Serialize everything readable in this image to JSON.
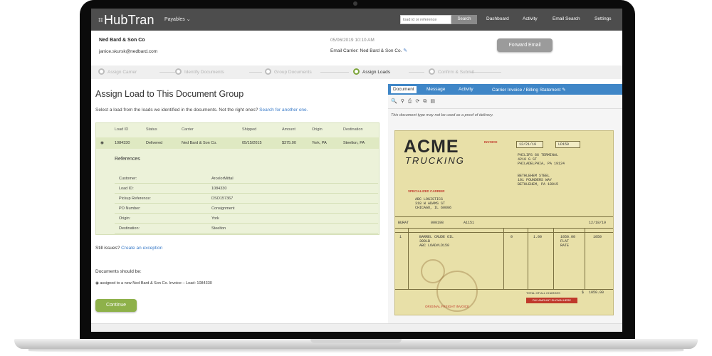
{
  "topnav": {
    "logo": "HubTran",
    "payables": "Payables",
    "search_placeholder": "load id or reference",
    "search_button": "Search",
    "links": [
      "Dashboard",
      "Activity",
      "Email Search",
      "Settings"
    ]
  },
  "info": {
    "company": "Ned Bard & Son Co",
    "email": "janice.skursk@nedbard.com",
    "date": "05/06/2019 10:10 AM",
    "carrier_label": "Email Carrier: Ned Bard & Son Co.",
    "forward_button": "Forward Email"
  },
  "steps": [
    {
      "label": "Assign Carrier",
      "active": false
    },
    {
      "label": "Identify Documents",
      "active": false
    },
    {
      "label": "Group Documents",
      "active": false
    },
    {
      "label": "Assign Loads",
      "active": true
    },
    {
      "label": "Confirm & Submit",
      "active": false
    }
  ],
  "left": {
    "title": "Assign Load to This Document Group",
    "subtitle": "Select a load from the loads we identified in the documents. Not the right ones?",
    "subtitle_link": "Search for another one.",
    "columns": [
      "Load ID",
      "Status",
      "Carrier",
      "Shipped",
      "Amount",
      "Origin",
      "Destination"
    ],
    "row": {
      "load_id": "1084330",
      "status": "Delivered",
      "carrier": "Ned Bard & Son Co.",
      "shipped": "05/15/2015",
      "amount": "$375.00",
      "origin": "York, PA",
      "destination": "Steelton, PA"
    },
    "references_title": "References",
    "references": [
      {
        "label": "Customer:",
        "value": "ArcelorMittal"
      },
      {
        "label": "Load ID:",
        "value": "1084330"
      },
      {
        "label": "Pickup Reference:",
        "value": "DSO157367"
      },
      {
        "label": "PO Number:",
        "value": "Consignment"
      },
      {
        "label": "Origin:",
        "value": "York"
      },
      {
        "label": "Destination:",
        "value": "Steelton"
      }
    ],
    "still_issues": "Still issues?",
    "create_exception": "Create an exception",
    "docs_should_be": "Documents should be:",
    "assigned_line": "assigned to a new Ned Bard & Son Co. Invoice – Load: 1084330",
    "continue_button": "Continue"
  },
  "right": {
    "tabs": [
      "Document",
      "Message",
      "Activity"
    ],
    "carrier_invoice": "Carrier Invoice / Billing Statement",
    "warning": "This document type may not be used as a proof of delivery.",
    "invoice": {
      "acme": "ACME",
      "trucking": "TRUCKING",
      "invoice_label": "INVOICE",
      "date": "12/21/19",
      "number": "LD150",
      "shipper": "PHILIPS 66 TERMINAL\n4210 G ST\nPHILADELPHIA, PA 19124",
      "consignee": "BETHLEHEM STEEL\n101 FOUNDERS WAY\nBETHLEHEM, PA 18015",
      "specialized": "SPECIALIZED CARRIER",
      "bill_to": "ABC LOGISTICS\n318 W ADAMS ST\nCHICAGO, IL 60606",
      "driver": "BURAT",
      "tractor": "000198",
      "trailer": "A1151",
      "load_date": "12/18/19",
      "item_no": "1",
      "description": "BARREL CRUDE OIL\n300LB\nABC LOAD#LD150",
      "weight": "0",
      "quantity": "1.00",
      "rate": "1050.00\nFLAT\nRATE",
      "amount": "1050",
      "total_label": "TOTAL OF ALL CHARGES",
      "total_currency": "$",
      "total": "1050.00",
      "pay_amount": "PAY AMOUNT SHOWN HERE",
      "original_invoice": "ORIGINAL FREIGHT INVOICE"
    }
  }
}
